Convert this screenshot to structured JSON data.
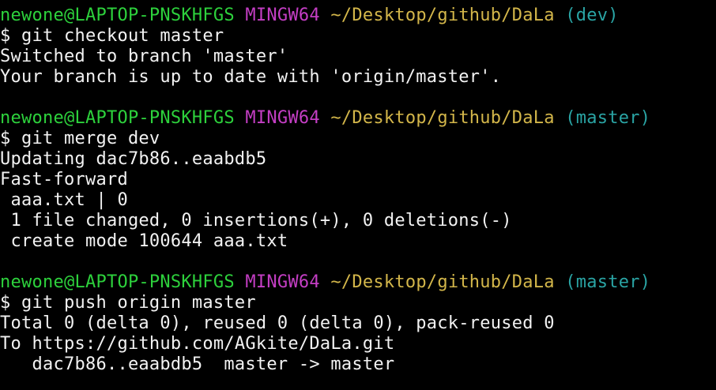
{
  "colors": {
    "background": "#000000",
    "user_host": "#2dd13c",
    "msystem": "#c43ec4",
    "path": "#d3b64a",
    "branch": "#2aa4a4",
    "text": "#f2f2f2"
  },
  "blocks": [
    {
      "prompt": {
        "user_host": "newone@LAPTOP-PNSKHFGS",
        "msystem": "MINGW64",
        "path": "~/Desktop/github/DaLa",
        "branch": "(dev)"
      },
      "command": "$ git checkout master",
      "output": [
        "Switched to branch 'master'",
        "Your branch is up to date with 'origin/master'."
      ]
    },
    {
      "prompt": {
        "user_host": "newone@LAPTOP-PNSKHFGS",
        "msystem": "MINGW64",
        "path": "~/Desktop/github/DaLa",
        "branch": "(master)"
      },
      "command": "$ git merge dev",
      "output": [
        "Updating dac7b86..eaabdb5",
        "Fast-forward",
        " aaa.txt | 0",
        " 1 file changed, 0 insertions(+), 0 deletions(-)",
        " create mode 100644 aaa.txt"
      ]
    },
    {
      "prompt": {
        "user_host": "newone@LAPTOP-PNSKHFGS",
        "msystem": "MINGW64",
        "path": "~/Desktop/github/DaLa",
        "branch": "(master)"
      },
      "command": "$ git push origin master",
      "output": [
        "Total 0 (delta 0), reused 0 (delta 0), pack-reused 0",
        "To https://github.com/AGkite/DaLa.git",
        "   dac7b86..eaabdb5  master -> master"
      ]
    }
  ]
}
